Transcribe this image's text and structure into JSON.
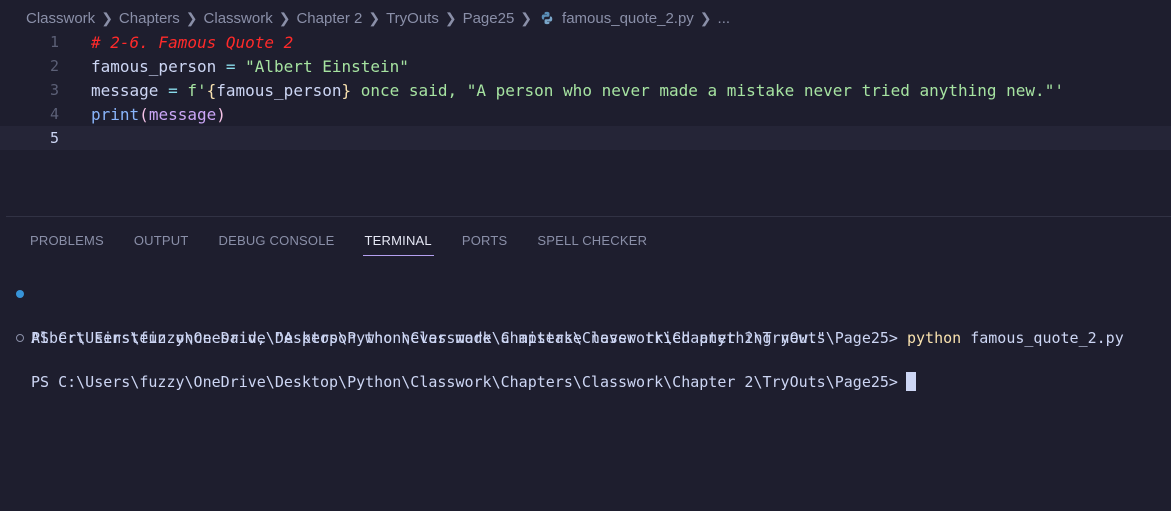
{
  "breadcrumb": {
    "items": [
      "Classwork",
      "Chapters",
      "Classwork",
      "Chapter 2",
      "TryOuts",
      "Page25"
    ],
    "file": "famous_quote_2.py",
    "ellipsis": "..."
  },
  "editor": {
    "line_numbers": [
      "1",
      "2",
      "3",
      "4",
      "5"
    ],
    "line1": {
      "comment": "# 2-6. Famous Quote 2"
    },
    "line2": {
      "var": "famous_person",
      "op": " = ",
      "str": "\"Albert Einstein\""
    },
    "line3": {
      "var": "message",
      "op": " = ",
      "fprefix": "f'",
      "brace_open": "{",
      "inner": "famous_person",
      "brace_close": "}",
      "rest": " once said, \"A person who never made a mistake never tried anything new.\"'"
    },
    "line4": {
      "fn": "print",
      "paren_open": "(",
      "param": "message",
      "paren_close": ")"
    }
  },
  "panel": {
    "tabs": [
      "PROBLEMS",
      "OUTPUT",
      "DEBUG CONSOLE",
      "TERMINAL",
      "PORTS",
      "SPELL CHECKER"
    ],
    "active_tab": "TERMINAL"
  },
  "terminal": {
    "prompt1": "PS C:\\Users\\fuzzy\\OneDrive\\Desktop\\Python\\Classwork\\Chapters\\Classwork\\Chapter 2\\TryOuts\\Page25> ",
    "cmd_python": "python",
    "cmd_args": " famous_quote_2.py",
    "output": "Albert Einstein once said, \"A person who never made a mistake never tried anything new.\"",
    "prompt2": "PS C:\\Users\\fuzzy\\OneDrive\\Desktop\\Python\\Classwork\\Chapters\\Classwork\\Chapter 2\\TryOuts\\Page25>"
  },
  "icons": {
    "file_icon": "python-file-icon",
    "success_dot": "#3794d8"
  }
}
